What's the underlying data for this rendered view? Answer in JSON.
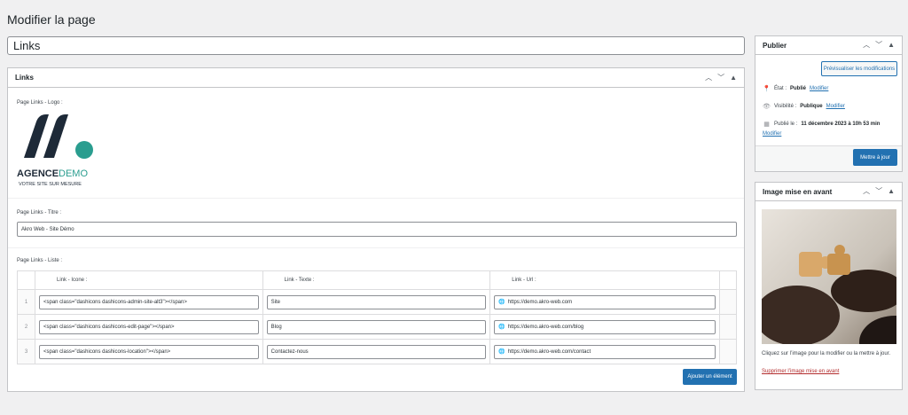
{
  "page": {
    "title": "Modifier la page",
    "post_title": "Links"
  },
  "links_box": {
    "title": "Links",
    "logo_label": "Page Links - Logo :",
    "logo_text_main": "AGENCE",
    "logo_text_accent": "DEMO",
    "logo_tagline": "VOTRE SITE SUR MESURE",
    "title_label": "Page Links - Titre :",
    "title_value": "Akro Web - Site Démo",
    "list_label": "Page Links - Liste :",
    "columns": [
      "Link - Icone :",
      "Link - Texte :",
      "Link - Url :"
    ],
    "rows": [
      {
        "num": "1",
        "icon": "<span class=\"dashicons dashicons-admin-site-alt3\"></span>",
        "text": "Site",
        "url": "https://demo.akro-web.com"
      },
      {
        "num": "2",
        "icon": "<span class=\"dashicons dashicons-edit-page\"></span>",
        "text": "Blog",
        "url": "https://demo.akro-web.com/blog"
      },
      {
        "num": "3",
        "icon": "<span class=\"dashicons dashicons-location\"></span>",
        "text": "Contactez-nous",
        "url": "https://demo.akro-web.com/contact"
      }
    ],
    "add_button": "Ajouter un élément"
  },
  "publish_box": {
    "title": "Publier",
    "preview_button": "Prévisualiser les modifications",
    "status_label": "État :",
    "status_value": "Publié",
    "status_edit": "Modifier",
    "visibility_label": "Visibilité :",
    "visibility_value": "Publique",
    "visibility_edit": "Modifier",
    "published_label": "Publié le :",
    "published_value": "11 décembre 2023 à 10h 53 min",
    "published_edit": "Modifier",
    "update_button": "Mettre à jour"
  },
  "featured_box": {
    "title": "Image mise en avant",
    "hint": "Cliquez sur l’image pour la modifier ou la mettre à jour.",
    "remove_link": "Supprimer l’image mise en avant"
  },
  "colors": {
    "accent": "#2271b1",
    "logo_dark": "#1e2a38",
    "logo_teal": "#2a9d8f"
  }
}
